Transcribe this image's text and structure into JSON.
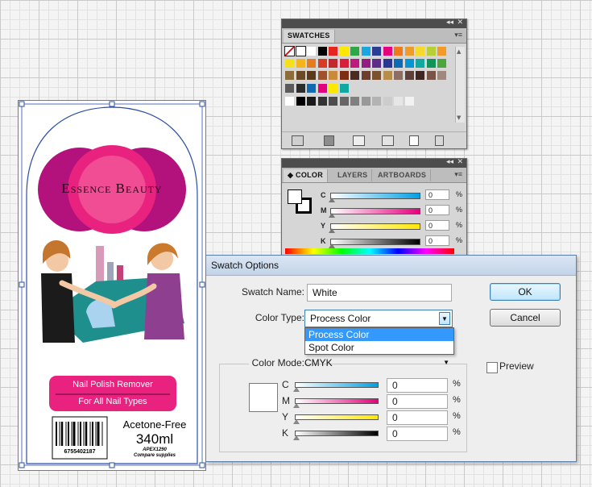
{
  "colors": {
    "accent": "#e9227f",
    "brand_pink": "#d0147a",
    "dialog_selection": "#3399ff",
    "selection_blue": "#2d4ea8"
  },
  "swatches": {
    "tab_label": "SWATCHES",
    "rows": [
      [
        "#ffffff",
        "#ffffff",
        "#ffffff",
        "#000000",
        "#e52520",
        "#ffe800",
        "#2ca847",
        "#1aa7df",
        "#2c3c93",
        "#e5007d",
        "#ee7a1c",
        "#ef9b27",
        "#f7d82b",
        "#b8d036",
        "#f39b26"
      ],
      [
        "#f4e11c",
        "#f6b41c",
        "#e77c1f",
        "#d73d25",
        "#c2272d",
        "#d61f3d",
        "#c1187f",
        "#931d80",
        "#5e2d8a",
        "#2b3690",
        "#0f6ab4",
        "#0595d3",
        "#12a8a2",
        "#10945a",
        "#4da63d"
      ],
      [
        "#8a6d3b",
        "#6a4b26",
        "#5a3a1b",
        "#a0522d",
        "#c98a3a",
        "#7c2d12",
        "#4b2c20",
        "#6b3e2e",
        "#7a5230",
        "#b68d4c",
        "#8d6e63",
        "#5d4037",
        "#3e2723",
        "#795548",
        "#a1887f"
      ],
      [
        "#5a5a5a",
        "#2c2c2c",
        "#0f6ab4",
        "#e5007d",
        "#ffe800",
        "#12a8a2"
      ],
      [
        "#ffffff",
        "#000000",
        "#1a1a1a",
        "#333333",
        "#4d4d4d",
        "#666666",
        "#808080",
        "#999999",
        "#b3b3b3",
        "#cccccc",
        "#e6e6e6",
        "#f2f2f2"
      ]
    ]
  },
  "color_panel": {
    "tabs": [
      "COLOR",
      "LAYERS",
      "ARTBOARDS"
    ],
    "channels": [
      {
        "label": "C",
        "value": "0",
        "unit": "%",
        "gradient": "linear-gradient(90deg,#ffffff,#00a0e4)"
      },
      {
        "label": "M",
        "value": "0",
        "unit": "%",
        "gradient": "linear-gradient(90deg,#ffffff,#e5007d)"
      },
      {
        "label": "Y",
        "value": "0",
        "unit": "%",
        "gradient": "linear-gradient(90deg,#ffffff,#ffe800)"
      },
      {
        "label": "K",
        "value": "0",
        "unit": "%",
        "gradient": "linear-gradient(90deg,#ffffff,#000000)"
      }
    ]
  },
  "dialog": {
    "title": "Swatch Options",
    "swatch_name_label": "Swatch Name:",
    "swatch_name_value": "White",
    "color_type_label": "Color Type:",
    "color_type_value": "Process Color",
    "color_type_options": [
      "Process Color",
      "Spot Color"
    ],
    "color_mode_label": "Color Mode:",
    "color_mode_value": "CMYK",
    "ok_label": "OK",
    "cancel_label": "Cancel",
    "preview_label": "Preview",
    "preview_checked": false,
    "channels": [
      {
        "label": "C",
        "value": "0",
        "unit": "%",
        "gradient": "linear-gradient(90deg,#ffffff,#00a0e4)"
      },
      {
        "label": "M",
        "value": "0",
        "unit": "%",
        "gradient": "linear-gradient(90deg,#ffffff,#e5007d)"
      },
      {
        "label": "Y",
        "value": "0",
        "unit": "%",
        "gradient": "linear-gradient(90deg,#ffffff,#ffe800)"
      },
      {
        "label": "K",
        "value": "0",
        "unit": "%",
        "gradient": "linear-gradient(90deg,#ffffff,#000000)"
      }
    ]
  },
  "label_art": {
    "brand": "Essence Beauty",
    "product_line1": "Nail Polish Remover",
    "product_line2": "For All Nail Types",
    "claim": "Acetone-Free",
    "volume": "340ml",
    "item_code": "APEX1290",
    "company": "Compare supplies",
    "barcode_number": "6755402187"
  }
}
